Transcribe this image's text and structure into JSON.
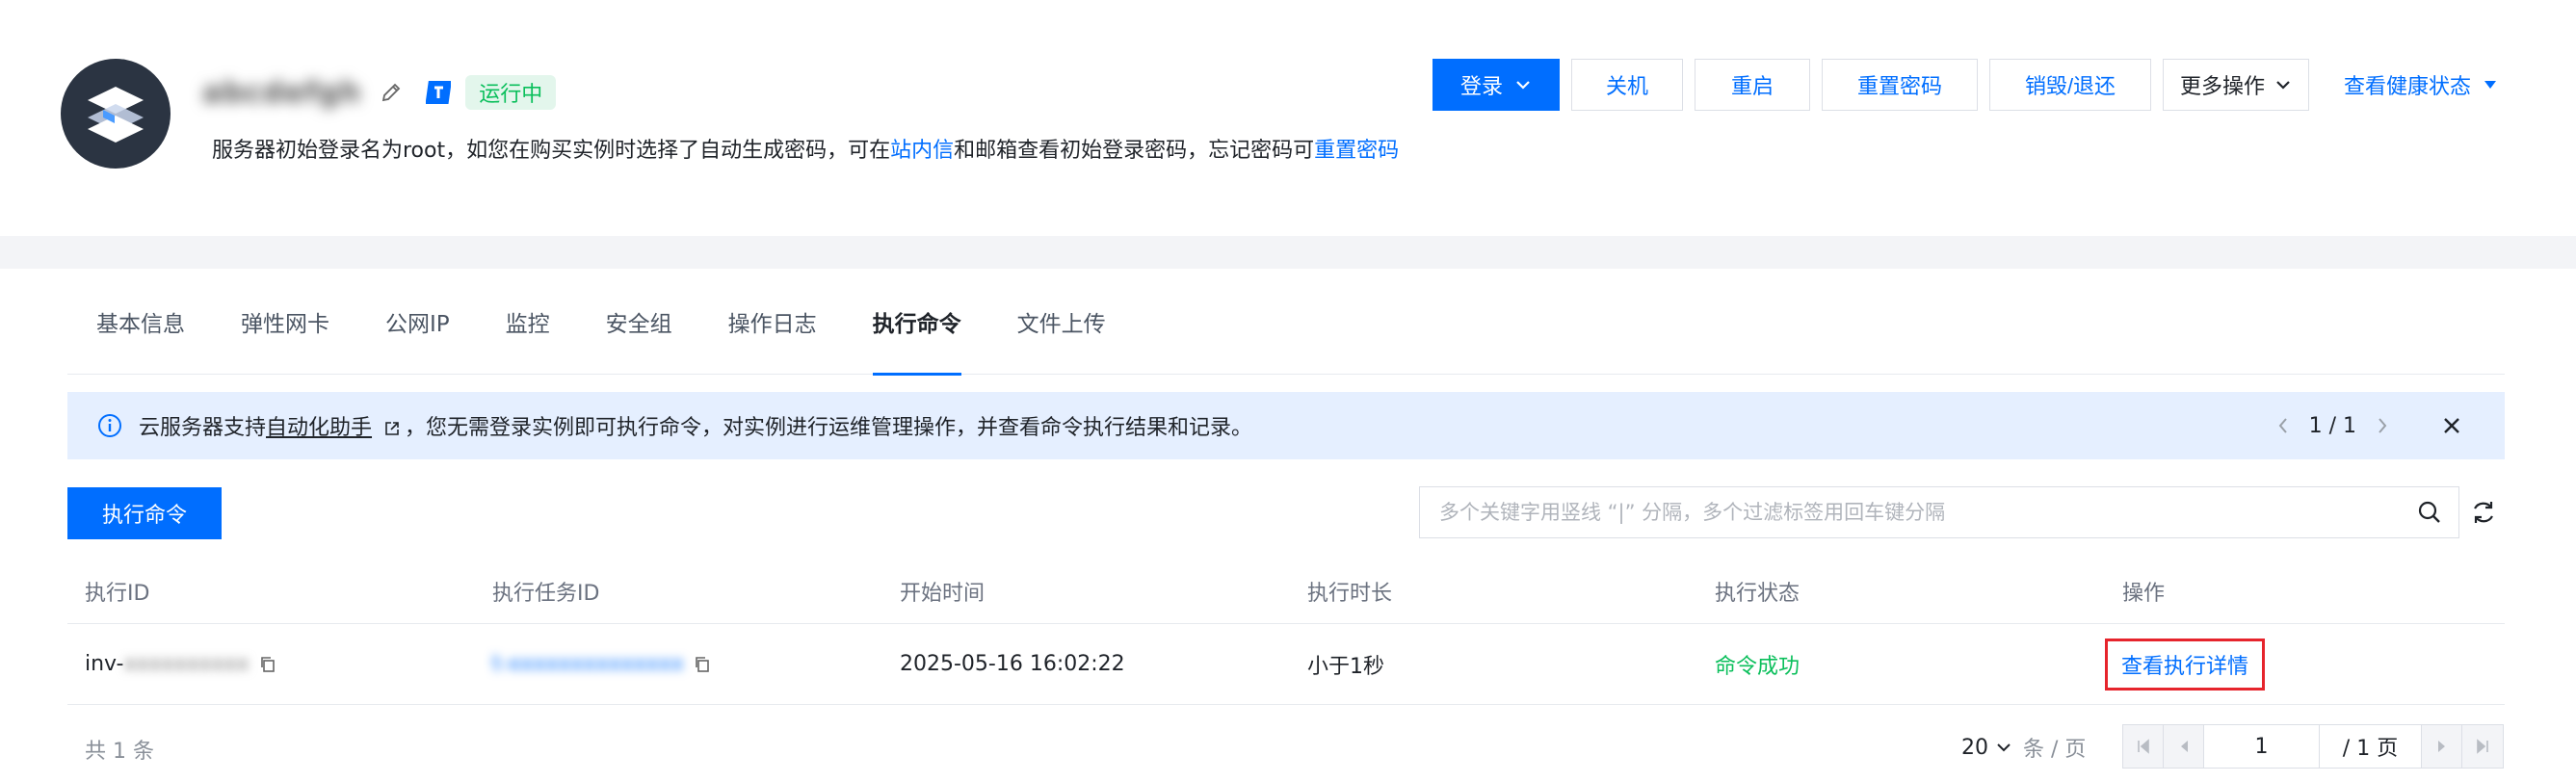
{
  "header": {
    "instance_name": "abcdefgh",
    "status": "运行中",
    "notice": {
      "part1": "服务器初始登录名为root，如您在购买实例时选择了自动生成密码，可在",
      "link1": "站内信",
      "part2": "和邮箱查看初始登录密码，忘记密码可",
      "link2": "重置密码"
    },
    "actions": {
      "login": "登录",
      "shutdown": "关机",
      "restart": "重启",
      "reset_password": "重置密码",
      "destroy": "销毁/退还",
      "more": "更多操作",
      "health": "查看健康状态"
    }
  },
  "tabs": [
    "基本信息",
    "弹性网卡",
    "公网IP",
    "监控",
    "安全组",
    "操作日志",
    "执行命令",
    "文件上传"
  ],
  "active_tab": "执行命令",
  "banner": {
    "prefix": "云服务器支持",
    "link": "自动化助手",
    "suffix": "，您无需登录实例即可执行命令，对实例进行运维管理操作，并查看命令执行结果和记录。",
    "page": "1 / 1"
  },
  "toolbar": {
    "run_label": "执行命令",
    "search_placeholder": "多个关键字用竖线 “|” 分隔，多个过滤标签用回车键分隔"
  },
  "table": {
    "columns": [
      "执行ID",
      "执行任务ID",
      "开始时间",
      "执行时长",
      "执行状态",
      "操作"
    ],
    "rows": [
      {
        "exec_id_prefix": "inv-",
        "exec_id_rest": "xxxxxxxxxx",
        "task_id": "t-xxxxxxxxxxxxxx",
        "start_time": "2025-05-16 16:02:22",
        "duration": "小于1秒",
        "status": "命令成功",
        "action": "查看执行详情"
      }
    ]
  },
  "footer": {
    "total": "共 1 条",
    "page_size": "20",
    "page_size_unit": "条 / 页",
    "current_page": "1",
    "total_pages": "/ 1 页"
  },
  "colors": {
    "primary": "#006eff",
    "success": "#0abf5b",
    "highlight_border": "#e6242c",
    "banner_bg": "#e5efff"
  }
}
